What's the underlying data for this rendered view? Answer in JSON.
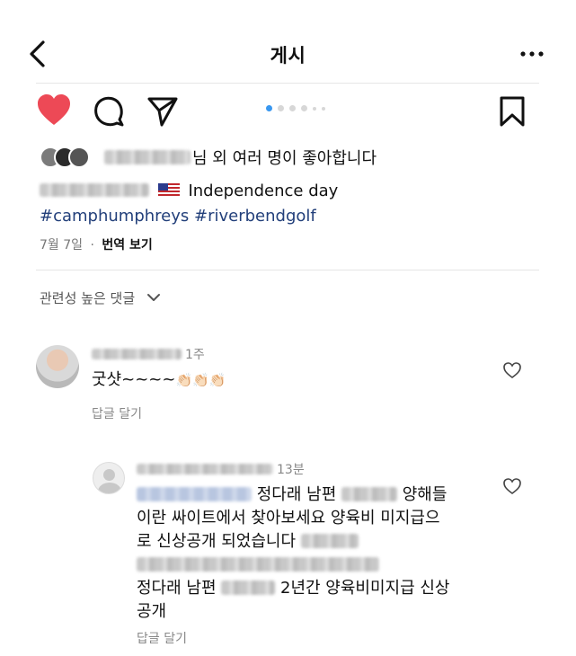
{
  "header": {
    "title": "게시"
  },
  "carousel": {
    "dots": 6,
    "active_index": 0
  },
  "likes": {
    "suffix": "님 외 여러 명이 좋아합니다"
  },
  "caption": {
    "text": "Independence day",
    "hashtags": [
      "#camphumphreys",
      "#riverbendgolf"
    ]
  },
  "meta": {
    "date": "7월 7일",
    "separator": "·",
    "translate": "번역 보기"
  },
  "comments_filter": {
    "label": "관련성 높은 댓글"
  },
  "comment1": {
    "time": "1주",
    "text": "굿샷~~~~",
    "emoji": "👏🏻👏🏻👏🏻",
    "reply": "답글 달기"
  },
  "comment2": {
    "time": "13분",
    "line1": "정다래 남편",
    "line1b": "양해들",
    "line2": "이란 싸이트에서 찾아보세요 양육비 미지급으",
    "line3": "로 신상공개 되었습니다",
    "line4": "정다래 남편",
    "line4b": "2년간 양육비미지급 신상",
    "line5": "공개",
    "reply": "답글 달기"
  },
  "colors": {
    "like_red": "#ed4956",
    "hashtag_blue": "#223f7a",
    "dot_active": "#3897f0"
  },
  "icons": {
    "back": "chevron-left-icon",
    "more": "more-horizontal-icon",
    "like": "heart-filled-icon",
    "comment": "comment-icon",
    "share": "send-icon",
    "save": "bookmark-icon",
    "filter": "chevron-down-icon",
    "comment_like": "heart-outline-icon"
  }
}
